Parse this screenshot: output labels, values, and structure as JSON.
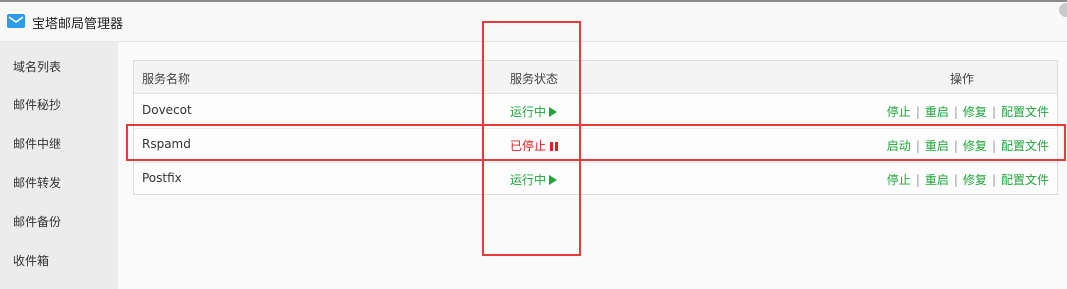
{
  "window": {
    "title": "宝塔邮局管理器"
  },
  "sidebar": {
    "items": [
      {
        "label": "域名列表"
      },
      {
        "label": "邮件秘抄"
      },
      {
        "label": "邮件中继"
      },
      {
        "label": "邮件转发"
      },
      {
        "label": "邮件备份"
      },
      {
        "label": "收件箱"
      }
    ]
  },
  "table": {
    "headers": {
      "name": "服务名称",
      "status": "服务状态",
      "ops": "操作"
    },
    "rows": [
      {
        "name": "Dovecot",
        "status": "运行中",
        "state": "running",
        "ops": [
          "停止",
          "重启",
          "修复",
          "配置文件"
        ]
      },
      {
        "name": "Rspamd",
        "status": "已停止",
        "state": "stopped",
        "ops": [
          "启动",
          "重启",
          "修复",
          "配置文件"
        ]
      },
      {
        "name": "Postfix",
        "status": "运行中",
        "state": "running",
        "ops": [
          "停止",
          "重启",
          "修复",
          "配置文件"
        ]
      }
    ],
    "separator": "|"
  },
  "colors": {
    "running": "#20a53a",
    "stopped": "#e02020",
    "annotation": "#e63b3b",
    "accent": "#2e9be8"
  },
  "icons": {
    "app": "mail-icon",
    "running": "play-icon",
    "stopped": "pause-icon"
  }
}
